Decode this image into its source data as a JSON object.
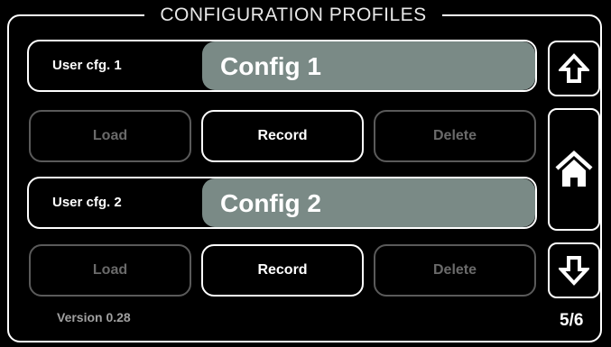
{
  "title": "CONFIGURATION PROFILES",
  "profiles": [
    {
      "label": "User cfg. 1",
      "name": "Config 1",
      "buttons": {
        "load": "Load",
        "record": "Record",
        "delete": "Delete"
      }
    },
    {
      "label": "User cfg. 2",
      "name": "Config 2",
      "buttons": {
        "load": "Load",
        "record": "Record",
        "delete": "Delete"
      }
    }
  ],
  "nav": {
    "up_icon": "arrow-up-icon",
    "home_icon": "home-icon",
    "down_icon": "arrow-down-icon"
  },
  "footer": {
    "version": "Version 0.28",
    "page": "5/6"
  },
  "colors": {
    "background": "#000000",
    "border": "#ffffff",
    "name_bar": "#7a8a86",
    "disabled": "#5a5a5a"
  }
}
